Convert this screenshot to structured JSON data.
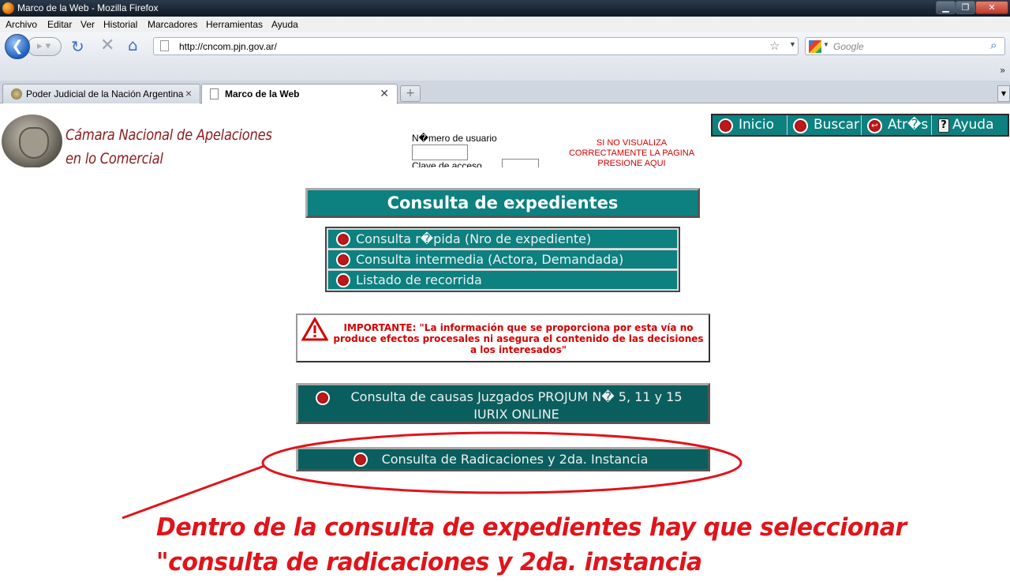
{
  "window": {
    "title": "Marco de la Web - Mozilla Firefox",
    "controls": {
      "minimize": "▁",
      "maximize": "❐",
      "close": "✕"
    }
  },
  "menu": [
    "Archivo",
    "Editar",
    "Ver",
    "Historial",
    "Marcadores",
    "Herramientas",
    "Ayuda"
  ],
  "nav": {
    "url": "http://cncom.pjn.gov.ar/",
    "search_placeholder": "Google",
    "icons": [
      "back-icon",
      "forward-icon",
      "reload-icon",
      "stop-icon",
      "home-icon",
      "bookmark-star-icon",
      "search-icon"
    ]
  },
  "tabs": [
    {
      "label": "Poder Judicial de la Nación Argentina",
      "active": false
    },
    {
      "label": "Marco de la Web",
      "active": true
    }
  ],
  "page": {
    "court_name_line1": "Cámara Nacional de Apelaciones",
    "court_name_line2": "en lo Comercial",
    "login_user_label": "N�mero de usuario",
    "login_pass_label": "Clave de acceso",
    "visual_warning": "SI NO VISUALIZA CORRECTAMENTE LA PAGINA PRESIONE AQUI",
    "top_nav": [
      {
        "label": "Inicio",
        "icon": "red-bullet-icon"
      },
      {
        "label": "Buscar",
        "icon": "red-bullet-icon"
      },
      {
        "label": "Atr�s",
        "icon": "back-arrow-icon"
      },
      {
        "label": "Ayuda",
        "icon": "help-icon"
      }
    ],
    "title": "Consulta de expedientes",
    "menu_items": [
      "Consulta r�pida (Nro de expediente)",
      "Consulta intermedia (Actora, Demandada)",
      "Listado de recorrida"
    ],
    "important_notice": "IMPORTANTE: \"La información que se proporciona por esta vía no produce efectos procesales ni asegura el contenido de las decisiones a los interesados\"",
    "projum_line1": "Consulta de causas Juzgados PROJUM N� 5, 11 y 15",
    "projum_line2": "IURIX ONLINE",
    "radicaciones_button": "Consulta de Radicaciones y 2da. Instancia"
  },
  "annotation": {
    "line1": "Dentro de la consulta de expedientes hay que seleccionar",
    "line2": "\"consulta de radicaciones y 2da. instancia",
    "color": "#e0141a"
  },
  "colors": {
    "teal": "#0d8080",
    "dark_teal": "#0b5e5e",
    "court_red": "#8b1a1a",
    "warning_red": "#d40000"
  }
}
